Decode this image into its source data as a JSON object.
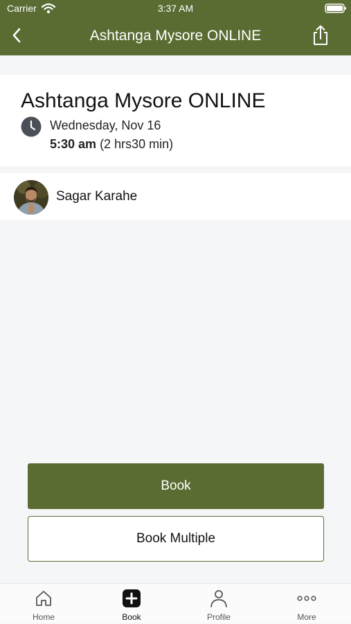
{
  "status_bar": {
    "carrier": "Carrier",
    "time": "3:37 AM"
  },
  "nav": {
    "title": "Ashtanga Mysore ONLINE"
  },
  "class": {
    "title": "Ashtanga Mysore ONLINE",
    "date": "Wednesday, Nov 16",
    "time": "5:30 am",
    "duration": "(2 hrs30 min)"
  },
  "instructor": {
    "name": "Sagar Karahe"
  },
  "actions": {
    "book_label": "Book",
    "book_multiple_label": "Book Multiple"
  },
  "tab_bar": {
    "tabs": [
      {
        "label": "Home",
        "icon": "home-icon"
      },
      {
        "label": "Book",
        "icon": "plus-square-icon"
      },
      {
        "label": "Profile",
        "icon": "person-icon"
      },
      {
        "label": "More",
        "icon": "ellipsis-icon"
      }
    ],
    "active": "Book"
  },
  "colors": {
    "brand_green": "#5a6c32",
    "background": "#f5f6f8"
  }
}
